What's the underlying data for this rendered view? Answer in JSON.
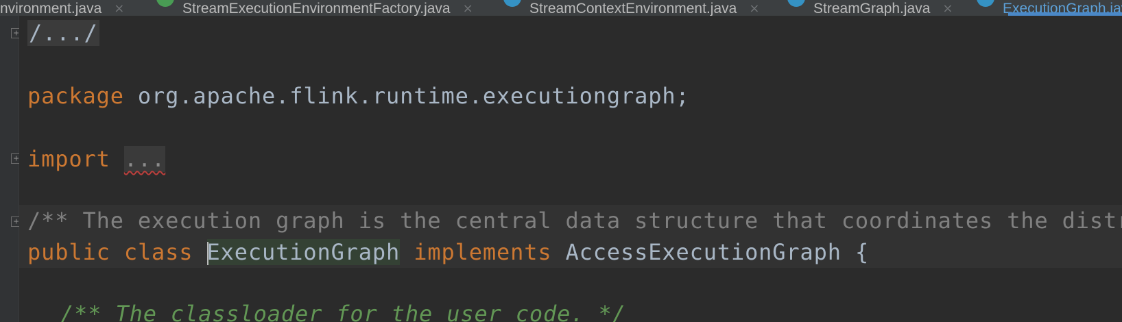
{
  "tabs": [
    {
      "label": "Environment.java",
      "icon": "none",
      "close": "×"
    },
    {
      "label": "StreamExecutionEnvironmentFactory.java",
      "icon": "green-circle",
      "close": "×"
    },
    {
      "label": "StreamContextEnvironment.java",
      "icon": "blue-circle",
      "close": "×"
    },
    {
      "label": "StreamGraph.java",
      "icon": "blue-circle",
      "close": "×"
    },
    {
      "label": "ExecutionGraph.java",
      "icon": "blue-circle",
      "active": true
    }
  ],
  "code": {
    "license_fold": "/.../",
    "package_keyword": "package",
    "package_name": " org.apache.flink.runtime.executiongraph;",
    "import_keyword": "import",
    "import_fold": "...",
    "javadoc": "/** The execution graph is the central data structure that coordinates the distributed execution of a data flow.",
    "class_public": "public",
    "class_keyword": "class",
    "class_name": "ExecutionGraph",
    "implements_keyword": "implements",
    "interface_name": "AccessExecutionGraph",
    "open_brace": "{",
    "next_comment": "/** The classloader for the user code. */"
  },
  "colors": {
    "background": "#2b2b2b",
    "keyword": "#cc7832",
    "identifier": "#a9b7c6",
    "comment": "#808080",
    "doc_comment": "#629755",
    "active_tab_underline": "#4a88c7"
  },
  "fold_marker_glyph": "+"
}
